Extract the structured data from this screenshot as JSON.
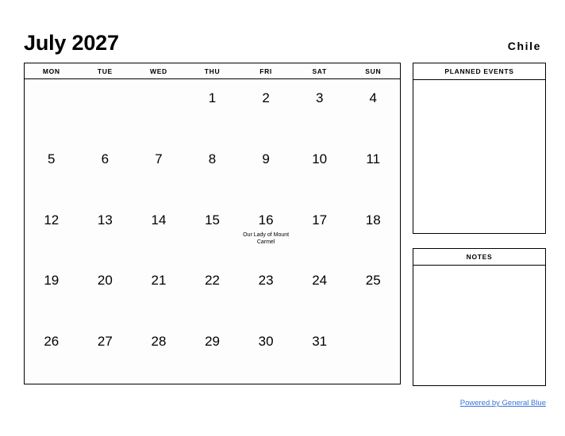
{
  "header": {
    "month_title": "July 2027",
    "country": "Chile"
  },
  "calendar": {
    "weekdays": [
      "MON",
      "TUE",
      "WED",
      "THU",
      "FRI",
      "SAT",
      "SUN"
    ],
    "weeks": [
      [
        {
          "day": ""
        },
        {
          "day": ""
        },
        {
          "day": ""
        },
        {
          "day": "1"
        },
        {
          "day": "2"
        },
        {
          "day": "3"
        },
        {
          "day": "4"
        }
      ],
      [
        {
          "day": "5"
        },
        {
          "day": "6"
        },
        {
          "day": "7"
        },
        {
          "day": "8"
        },
        {
          "day": "9"
        },
        {
          "day": "10"
        },
        {
          "day": "11"
        }
      ],
      [
        {
          "day": "12"
        },
        {
          "day": "13"
        },
        {
          "day": "14"
        },
        {
          "day": "15"
        },
        {
          "day": "16",
          "event": "Our Lady of Mount Carmel"
        },
        {
          "day": "17"
        },
        {
          "day": "18"
        }
      ],
      [
        {
          "day": "19"
        },
        {
          "day": "20"
        },
        {
          "day": "21"
        },
        {
          "day": "22"
        },
        {
          "day": "23"
        },
        {
          "day": "24"
        },
        {
          "day": "25"
        }
      ],
      [
        {
          "day": "26"
        },
        {
          "day": "27"
        },
        {
          "day": "28"
        },
        {
          "day": "29"
        },
        {
          "day": "30"
        },
        {
          "day": "31"
        },
        {
          "day": ""
        }
      ]
    ]
  },
  "panels": {
    "planned_events": {
      "title": "PLANNED EVENTS",
      "content": ""
    },
    "notes": {
      "title": "NOTES",
      "content": ""
    }
  },
  "footer": {
    "link_label": "Powered by General Blue"
  },
  "colors": {
    "link": "#3b72d9",
    "border": "#000000",
    "text": "#000000",
    "background": "#ffffff"
  }
}
